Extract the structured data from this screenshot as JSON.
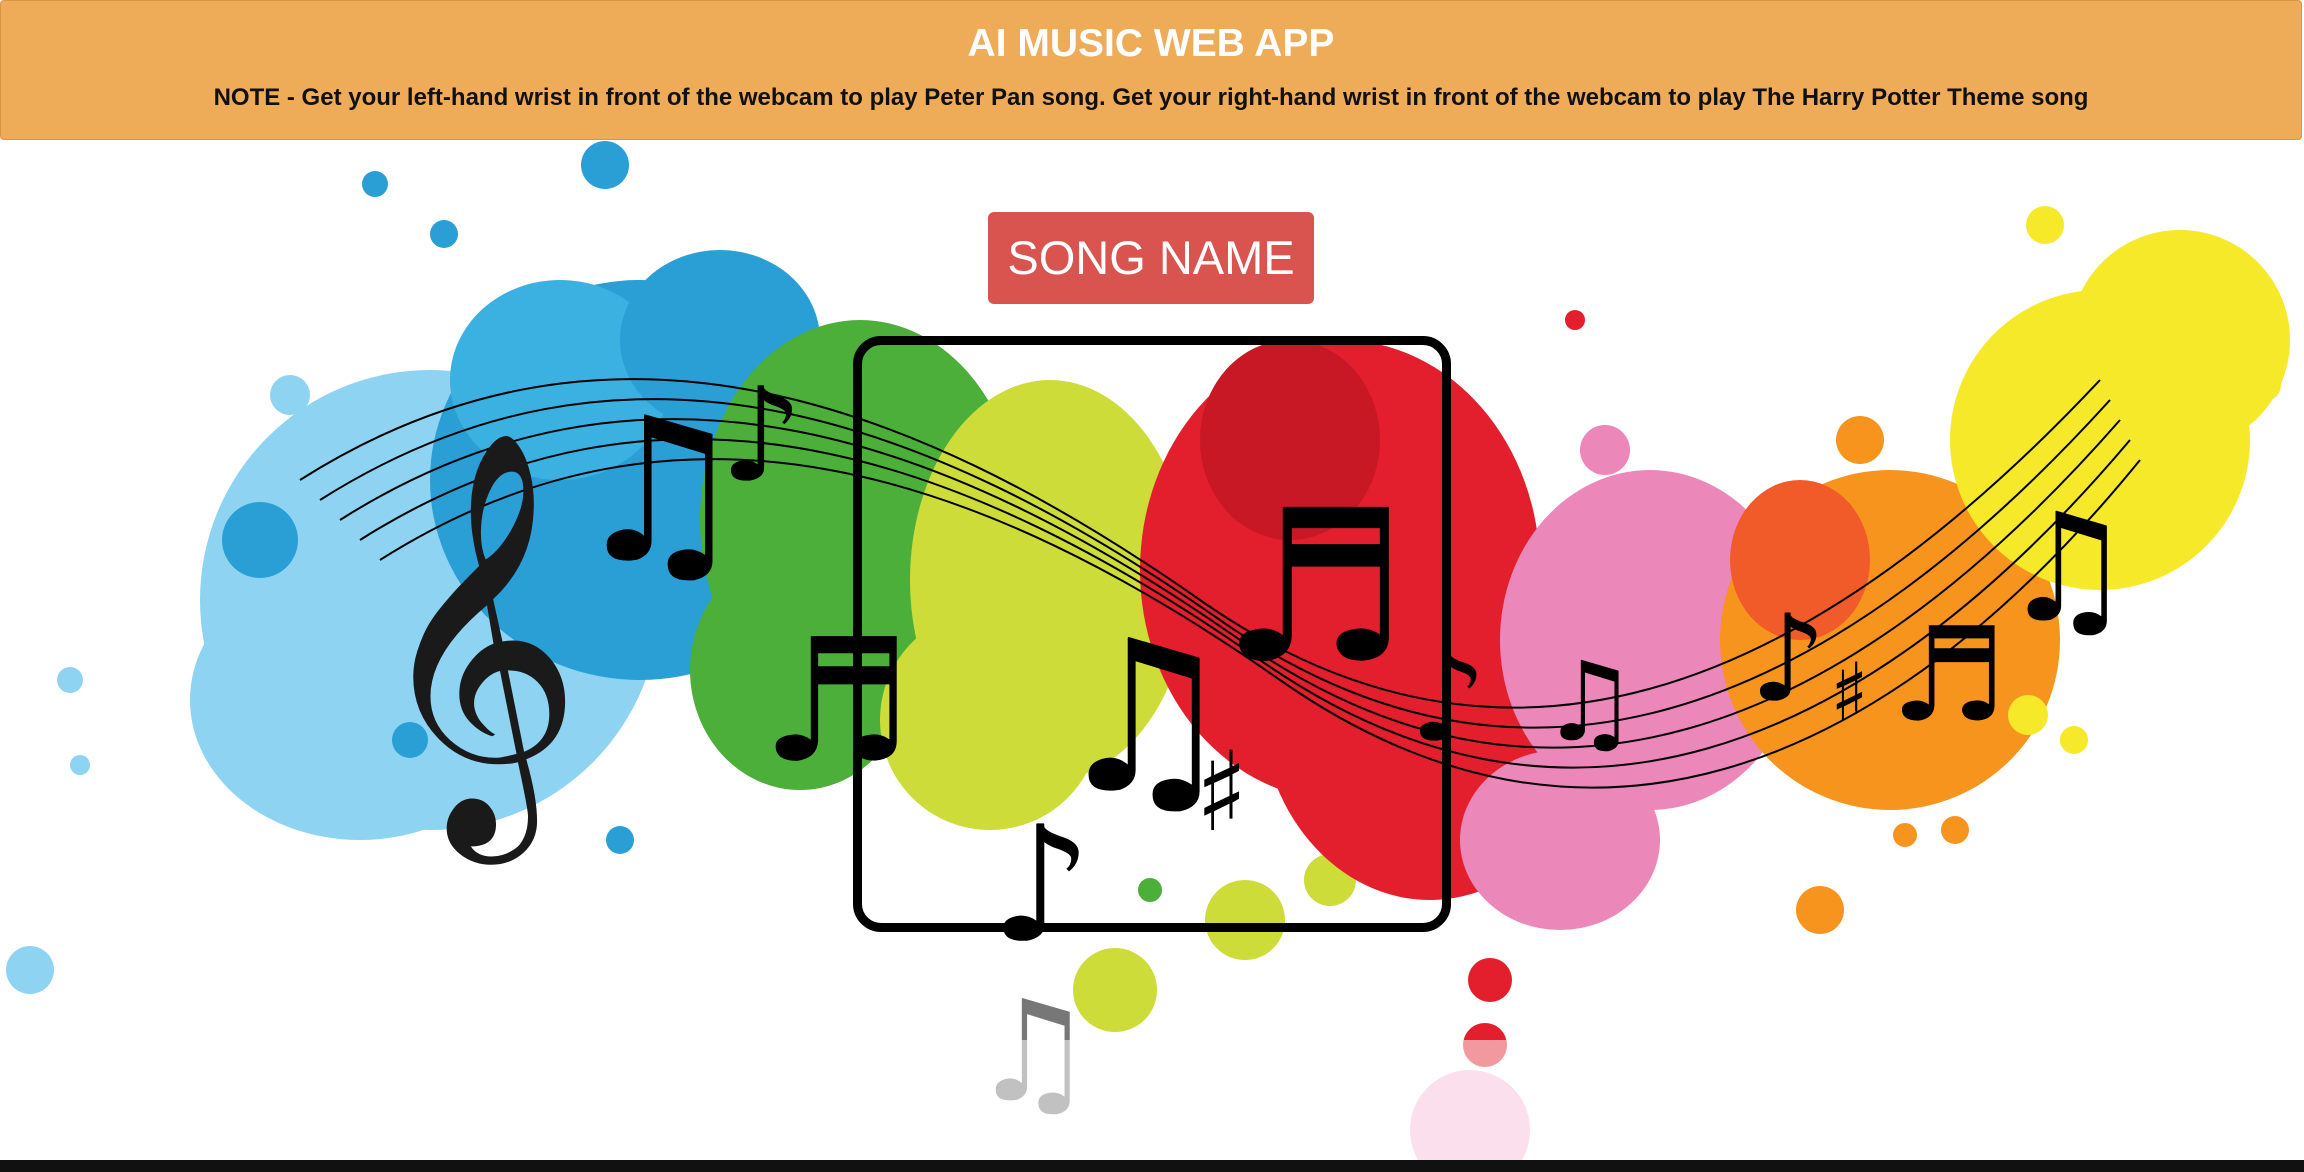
{
  "header": {
    "title": "AI MUSIC WEB APP",
    "note": "NOTE - Get your left-hand wrist in front of the webcam to play Peter Pan song. Get your right-hand wrist in front of the webcam to play The Harry Potter Theme song"
  },
  "song_button": {
    "label": "SONG NAME"
  },
  "colors": {
    "header_bg": "#eeab58",
    "song_button_bg": "#d9534f",
    "splash_blue": "#2a9fd6",
    "splash_green": "#4caf3a",
    "splash_lime": "#cddc39",
    "splash_red": "#e31e2d",
    "splash_pink": "#ec87b9",
    "splash_orange": "#f7941d",
    "splash_yellow": "#f5e92a"
  },
  "icons": [
    "treble-clef-icon",
    "music-note-icon",
    "sharp-icon"
  ]
}
